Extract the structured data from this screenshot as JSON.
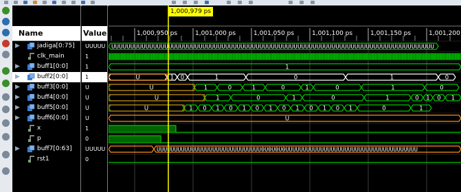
{
  "cursor": {
    "time": "1,000,979 ps",
    "color": "#ffff00"
  },
  "headers": {
    "name": "Name",
    "value": "Value"
  },
  "timeline": {
    "ticks": [
      "1,000,950 ps",
      "1,001,000 ps",
      "1,001,050 ps",
      "1,001,100 ps",
      "1,001,150 ps",
      "1,001,200"
    ]
  },
  "signals": [
    {
      "name": "jadiga[0:75]",
      "value": "UUUUU",
      "type": "bus",
      "expandable": true
    },
    {
      "name": "clk_main",
      "value": "1",
      "type": "clock",
      "expandable": false
    },
    {
      "name": "buff1[0:0]",
      "value": "1",
      "type": "bus",
      "expandable": true
    },
    {
      "name": "buff2[0:0]",
      "value": "1",
      "type": "bus",
      "expandable": true,
      "selected": true
    },
    {
      "name": "buff3[0:0]",
      "value": "U",
      "type": "bus",
      "expandable": true
    },
    {
      "name": "buff4[0:0]",
      "value": "U",
      "type": "bus",
      "expandable": true
    },
    {
      "name": "buff5[0:0]",
      "value": "U",
      "type": "bus",
      "expandable": true
    },
    {
      "name": "buff6[0:0]",
      "value": "U",
      "type": "bus",
      "expandable": true
    },
    {
      "name": "x",
      "value": "1",
      "type": "bit",
      "expandable": false
    },
    {
      "name": "p",
      "value": "0",
      "type": "bit",
      "expandable": false
    },
    {
      "name": "buff7[0:63]",
      "value": "UUUUU",
      "type": "bus",
      "expandable": true
    },
    {
      "name": "rst1",
      "value": "0",
      "type": "bit",
      "expandable": false
    }
  ],
  "waves": {
    "jadiga": "UUUUUUUUUUUUUUUUUUUUUUUUUUUUUUUUUUUUUUUUUUUUUUUUUUUUUUUUUUUUUUUUUUUUUUUUUUUUUUUUUUUUU",
    "buff1": "1",
    "buff2": [
      "U",
      "1",
      "0",
      "1",
      "0",
      "1",
      "0"
    ],
    "buff3": [
      "U",
      "1",
      "0",
      "1",
      "0",
      "1",
      "0",
      "1",
      "0"
    ],
    "buff4": [
      "U",
      "1",
      "0",
      "1",
      "0",
      "1",
      "0",
      "1",
      "0",
      "1"
    ],
    "buff5": [
      "U",
      "1",
      "0",
      "1",
      "0",
      "1",
      "0",
      "1",
      "0",
      "1",
      "0",
      "1",
      "0",
      "1",
      "0",
      "1"
    ],
    "buff6": "U",
    "buff7": "UUUUUUUUUUUUUUUUUUUUUUUUUUUUUU0U0U0U0UUUUUUUUUUUUUUUUUUUUUUUUUUUUUUUUUUUUUU"
  },
  "colors": {
    "wave": "#00c800",
    "bus_u": "#ff8c1a",
    "selected_bus": "#ffffff",
    "grid": "#3c3c3c",
    "cursor": "#ffff00"
  }
}
